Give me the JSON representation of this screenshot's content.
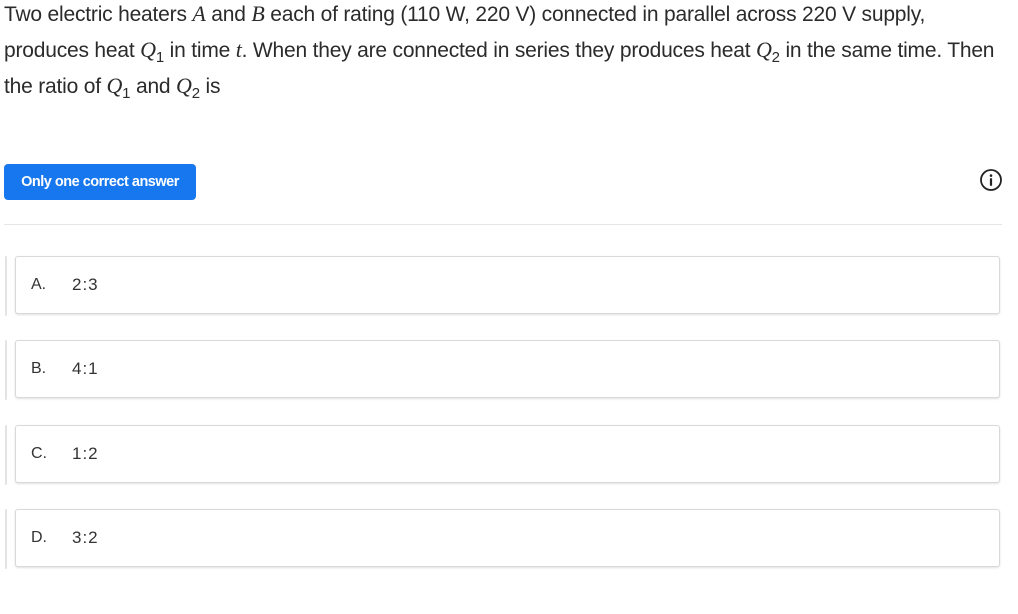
{
  "question": {
    "seg1": "Two electric heaters ",
    "var_a": "A",
    "seg2": " and ",
    "var_b": "B",
    "seg3": " each of rating (110 W, 220 V) connected in parallel across 220 V supply, produces heat ",
    "q1_letter": "Q",
    "q1_sub": "1",
    "seg4": " in time ",
    "var_t": "t",
    "seg5": ". When they are connected in series they produces heat ",
    "q2_letter": "Q",
    "q2_sub": "2",
    "seg6": " in the same time. Then the ratio of ",
    "q1b_letter": "Q",
    "q1b_sub": "1",
    "seg7": " and ",
    "q2b_letter": "Q",
    "q2b_sub": "2",
    "seg8": " is"
  },
  "answer_type": {
    "label": "Only one correct answer",
    "color": "#1677ee"
  },
  "info_icon": "info-icon",
  "options": [
    {
      "letter": "A.",
      "value": "2:3"
    },
    {
      "letter": "B.",
      "value": "4:1"
    },
    {
      "letter": "C.",
      "value": "1:2"
    },
    {
      "letter": "D.",
      "value": "3:2"
    }
  ]
}
